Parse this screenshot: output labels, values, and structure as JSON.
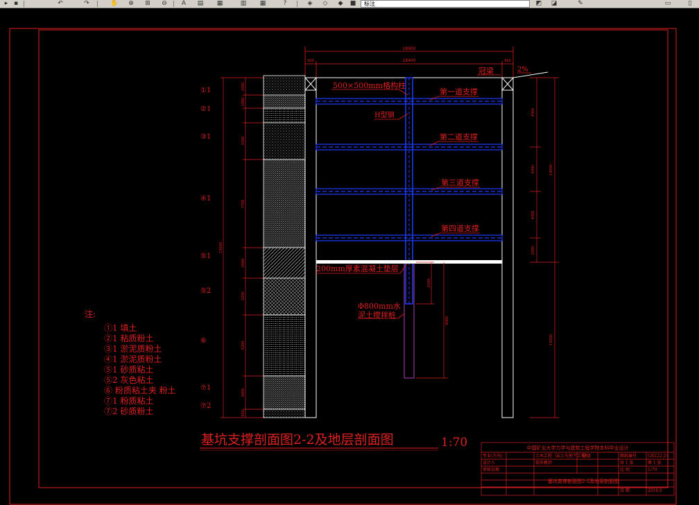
{
  "toolbar": {
    "layer_name": "标注",
    "icons": [
      "open-icon",
      "save-icon",
      "undo-icon",
      "redo-icon",
      "pan-icon",
      "zoom-realtime-icon",
      "zoom-window-icon",
      "zoom-previous-icon",
      "properties-icon",
      "text-style-icon",
      "layer-manager-icon",
      "table-icon",
      "help-icon",
      "layer-state-icon",
      "color-icon",
      "linetype-icon"
    ]
  },
  "colors": {
    "red": "#e02020",
    "white": "#ffffff",
    "blue": "#1f3cff",
    "magenta": "#b040c0"
  },
  "dims": {
    "total_width": "18900",
    "left_gap": "600",
    "inner_width": "18400",
    "right_gap": "600",
    "left_layers": [
      "1000",
      "1000",
      "3100",
      "7700",
      "2600",
      "3200",
      "5200",
      "3000",
      "500"
    ],
    "total_depth": "23000",
    "right_segments": [
      "4000",
      "4000",
      "4000",
      "2000"
    ],
    "right_sum": "14000",
    "right_total": "13000",
    "pile_upper": "2500",
    "pile_total": "8000"
  },
  "strata": [
    {
      "code": "①1"
    },
    {
      "code": "②1"
    },
    {
      "code": "③1"
    },
    {
      "code": "④1"
    },
    {
      "code": "⑤1"
    },
    {
      "code": "⑤2"
    },
    {
      "code": "⑥"
    },
    {
      "code": "⑦1"
    },
    {
      "code": "⑦2"
    }
  ],
  "labels": {
    "column": "500×500mm格构柱",
    "steel": "H型钢",
    "strut1": "第一道支撑",
    "strut2": "第二道支撑",
    "strut3": "第三道支撑",
    "strut4": "第四道支撑",
    "cushion": "200mm厚素混凝土垫层",
    "pile_1": "Φ800mm水",
    "pile_2": "泥土搅拌桩",
    "cap_beam": "冠梁",
    "slope": "2%"
  },
  "notes": {
    "heading": "注:",
    "items": [
      "①1 填土",
      "②1 粘质粉土",
      "③1 淤泥质粉土",
      "④1 淤泥质粉土",
      "⑤1 砂质粘土",
      "⑤2 灰色粘土",
      "⑥ 粉质粘土夹 粉土",
      "⑦1 粉质粘土",
      "⑦2 砂质粉土"
    ]
  },
  "title": {
    "main": "基坑支撑剖面图2-2及地层剖面图",
    "scale": "1:70"
  },
  "titleblock": {
    "header": "中国矿业大学力学与建筑工程学院本科毕业设计",
    "rows": [
      [
        "专业(方向)",
        "土木工程（岩土与地下工程）",
        "",
        "班级",
        "",
        "图纸编号",
        "GB222-24"
      ],
      [
        "设计人",
        "",
        "指导教师",
        "",
        "",
        "比 例",
        "1/70"
      ],
      [
        "审核日期",
        "",
        "",
        "",
        "",
        "共 1 张",
        "第 1 张"
      ],
      [
        "",
        "基坑支撑剖面图2-2及地层剖面图",
        "",
        "",
        "",
        "日 期",
        "2016.6"
      ]
    ]
  }
}
